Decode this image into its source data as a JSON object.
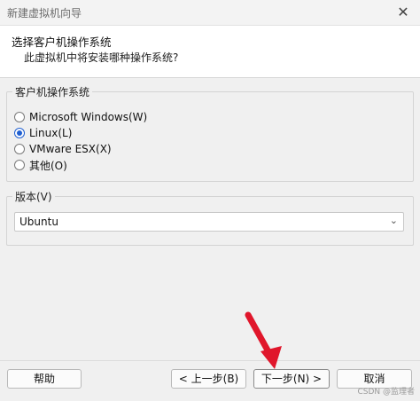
{
  "window": {
    "title": "新建虚拟机向导",
    "close_glyph": "✕"
  },
  "header": {
    "title": "选择客户机操作系统",
    "subtitle": "此虚拟机中将安装哪种操作系统?"
  },
  "os_group": {
    "legend": "客户机操作系统",
    "options": [
      {
        "label": "Microsoft Windows(W)",
        "selected": false
      },
      {
        "label": "Linux(L)",
        "selected": true
      },
      {
        "label": "VMware ESX(X)",
        "selected": false
      },
      {
        "label": "其他(O)",
        "selected": false
      }
    ]
  },
  "version_group": {
    "legend": "版本(V)",
    "selected": "Ubuntu"
  },
  "buttons": {
    "help": "帮助",
    "back": "< 上一步(B)",
    "next": "下一步(N) >",
    "cancel": "取消"
  },
  "watermark": "CSDN @监理者",
  "colors": {
    "accent": "#1f5fd1",
    "arrow": "#e0162b"
  }
}
